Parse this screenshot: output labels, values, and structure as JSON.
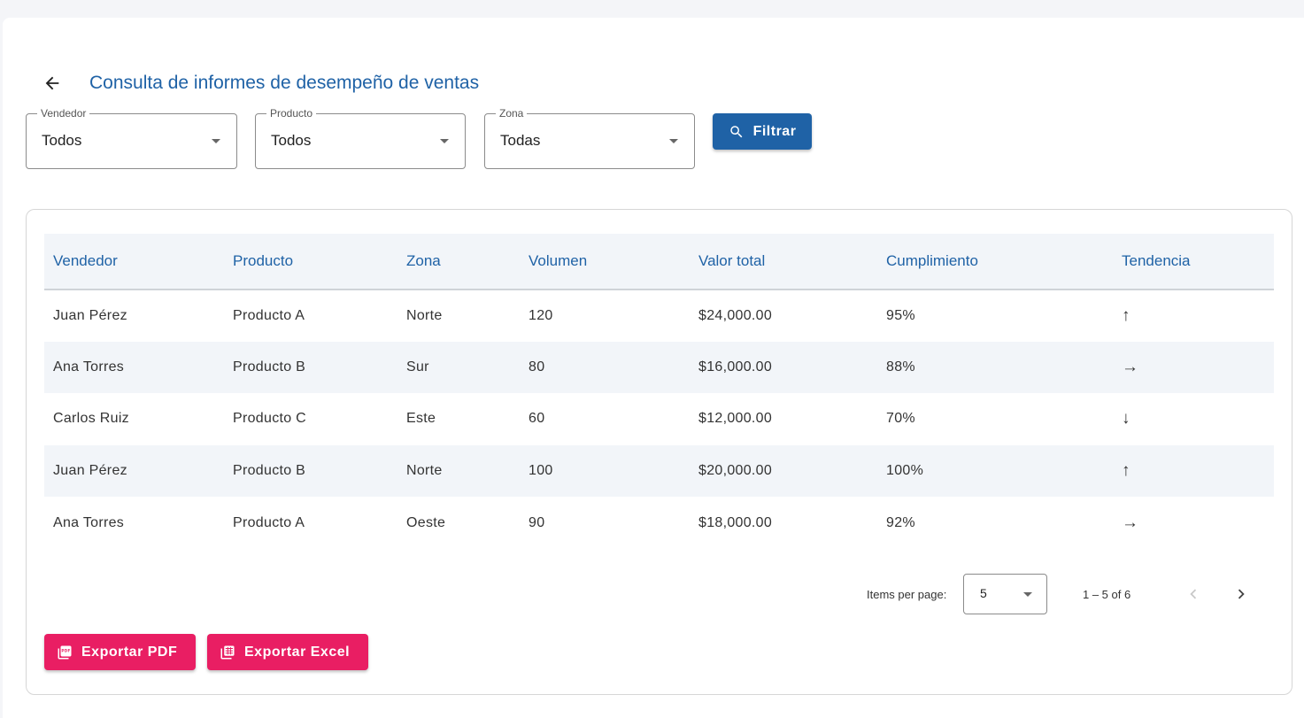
{
  "header": {
    "title": "Consulta de informes de desempeño de ventas"
  },
  "filters": {
    "vendedor": {
      "label": "Vendedor",
      "value": "Todos"
    },
    "producto": {
      "label": "Producto",
      "value": "Todos"
    },
    "zona": {
      "label": "Zona",
      "value": "Todas"
    },
    "filter_button": "Filtrar"
  },
  "table": {
    "columns": [
      "Vendedor",
      "Producto",
      "Zona",
      "Volumen",
      "Valor total",
      "Cumplimiento",
      "Tendencia"
    ],
    "rows": [
      [
        "Juan Pérez",
        "Producto A",
        "Norte",
        "120",
        "$24,000.00",
        "95%",
        "↑"
      ],
      [
        "Ana Torres",
        "Producto B",
        "Sur",
        "80",
        "$16,000.00",
        "88%",
        "→"
      ],
      [
        "Carlos Ruiz",
        "Producto C",
        "Este",
        "60",
        "$12,000.00",
        "70%",
        "↓"
      ],
      [
        "Juan Pérez",
        "Producto B",
        "Norte",
        "100",
        "$20,000.00",
        "100%",
        "↑"
      ],
      [
        "Ana Torres",
        "Producto A",
        "Oeste",
        "90",
        "$18,000.00",
        "92%",
        "→"
      ]
    ]
  },
  "paginator": {
    "items_per_page_label": "Items per page:",
    "page_size": "5",
    "range_label": "1 – 5 of 6"
  },
  "actions": {
    "export_pdf": "Exportar PDF",
    "export_excel": "Exportar Excel"
  },
  "colors": {
    "primary": "#1f62a6",
    "accent": "#e91e63",
    "stripe": "#f2f5f9"
  }
}
